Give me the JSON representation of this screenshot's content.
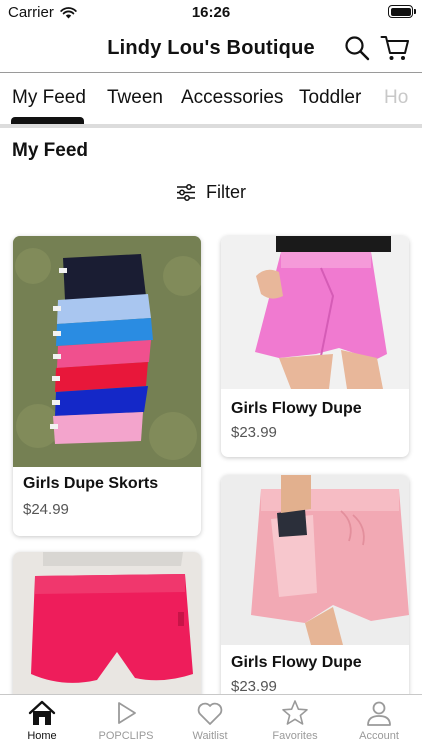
{
  "status_bar": {
    "carrier": "Carrier",
    "time": "16:26"
  },
  "header": {
    "title": "Lindy Lou's Boutique"
  },
  "tabs": [
    "My Feed",
    "Tween",
    "Accessories",
    "Toddler",
    "Ho"
  ],
  "active_tab": "My Feed",
  "feed": {
    "title": "My Feed",
    "filter_label": "Filter"
  },
  "products": [
    {
      "name": "Girls Dupe Skorts",
      "price": "$24.99"
    },
    {
      "name": "Girls Flowy Dupe",
      "price": "$23.99"
    },
    {
      "name": "",
      "price": ""
    },
    {
      "name": "Girls Flowy Dupe",
      "price": "$23.99"
    }
  ],
  "nav": [
    {
      "label": "Home",
      "icon": "home-icon",
      "active": true
    },
    {
      "label": "POPCLIPS",
      "icon": "play-icon",
      "active": false
    },
    {
      "label": "Waitlist",
      "icon": "heart-icon",
      "active": false
    },
    {
      "label": "Favorites",
      "icon": "star-icon",
      "active": false
    },
    {
      "label": "Account",
      "icon": "person-icon",
      "active": false
    }
  ],
  "colors": {
    "text": "#111111",
    "inactive": "#9a9a9a",
    "card_shadow": "#000000"
  }
}
